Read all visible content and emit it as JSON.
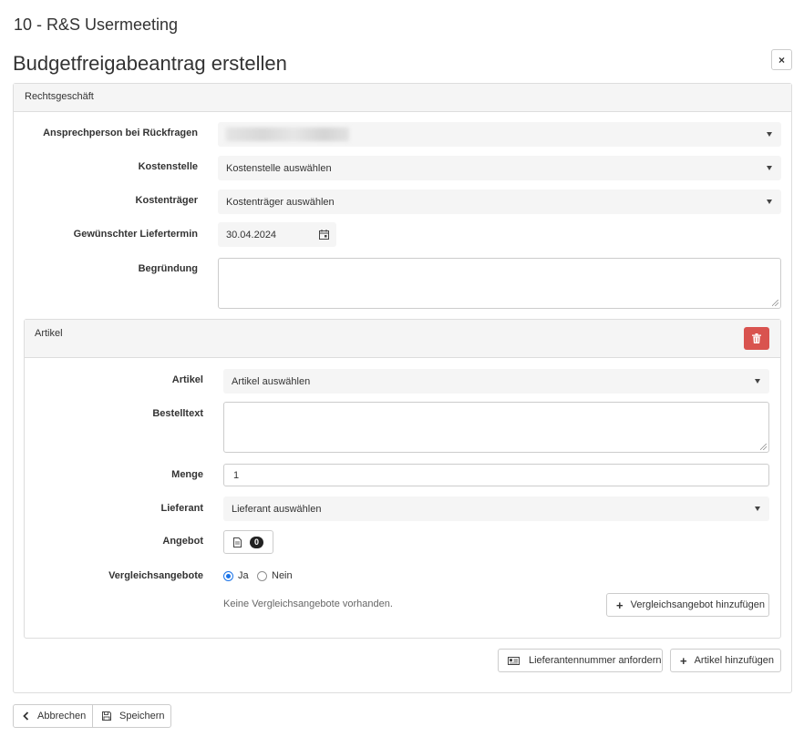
{
  "header": {
    "super_title": "10 - R&S Usermeeting",
    "title": "Budgetfreigabeantrag erstellen",
    "close_label": "×"
  },
  "section": {
    "title": "Rechtsgeschäft",
    "fields": {
      "contact_label": "Ansprechperson bei Rückfragen",
      "cost_center_label": "Kostenstelle",
      "cost_center_value": "Kostenstelle auswählen",
      "cost_unit_label": "Kostenträger",
      "cost_unit_value": "Kostenträger auswählen",
      "delivery_date_label": "Gewünschter Liefertermin",
      "delivery_date_value": "30.04.2024",
      "reason_label": "Begründung"
    }
  },
  "article": {
    "title": "Artikel",
    "article_label": "Artikel",
    "article_value": "Artikel auswählen",
    "order_text_label": "Bestelltext",
    "quantity_label": "Menge",
    "quantity_value": "1",
    "supplier_label": "Lieferant",
    "supplier_value": "Lieferant auswählen",
    "offer_label": "Angebot",
    "offer_count": "0",
    "comparison_label": "Vergleichsangebote",
    "comparison_yes": "Ja",
    "comparison_no": "Nein",
    "comparison_selected": "Ja",
    "no_comparisons_text": "Keine Vergleichsangebote vorhanden.",
    "add_comparison_button": "Vergleichsangebot hinzufügen"
  },
  "panel_actions": {
    "request_supplier_number": "Lieferantennummer anfordern",
    "add_article": "Artikel hinzufügen"
  },
  "footer": {
    "cancel": "Abbrechen",
    "save": "Speichern"
  },
  "colors": {
    "danger": "#d9534f",
    "panel_heading": "#f5f5f5",
    "radio_accent": "#1a73e8"
  }
}
